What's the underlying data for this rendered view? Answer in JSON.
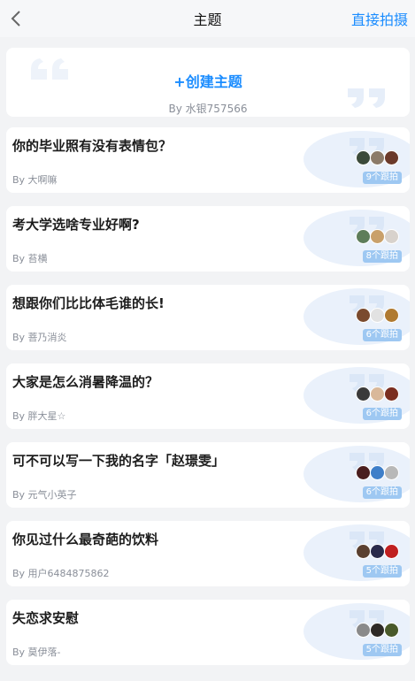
{
  "nav": {
    "title": "主题",
    "action_label": "直接拍摄"
  },
  "create": {
    "label": "+创建主题",
    "byline": "By 水银757566"
  },
  "topics": [
    {
      "title": "你的毕业照有没有表情包？",
      "author": "By 大啊嘛",
      "count": "9个跟拍",
      "avatar_colors": [
        "#3b4a3a",
        "#8b7a68",
        "#6b3a2a"
      ]
    },
    {
      "title": "考大学选啥专业好啊?",
      "author": "By 苔横",
      "count": "8个跟拍",
      "avatar_colors": [
        "#5e7d5a",
        "#c9a06a",
        "#d8d2cc"
      ]
    },
    {
      "title": "想跟你们比比体毛谁的长!",
      "author": "By 菩乃消炎",
      "count": "6个跟拍",
      "avatar_colors": [
        "#7a4a2e",
        "#e2e2e2",
        "#b07a30"
      ]
    },
    {
      "title": "大家是怎么消暑降温的？",
      "author": "By 胖大星☆",
      "count": "6个跟拍",
      "avatar_colors": [
        "#3a3a3a",
        "#d9b89a",
        "#7a2e20"
      ]
    },
    {
      "title": "可不可以写一下我的名字「赵璟雯」",
      "author": "By 元气小英子",
      "count": "6个跟拍",
      "avatar_colors": [
        "#4a1e1e",
        "#3f7fc9",
        "#b8b8b8"
      ]
    },
    {
      "title": "你见过什么最奇葩的饮料",
      "author": "By 用户6484875862",
      "count": "5个跟拍",
      "avatar_colors": [
        "#5a4030",
        "#2a2a4a",
        "#c02020"
      ]
    },
    {
      "title": "失恋求安慰",
      "author": "By 莫伊落-",
      "count": "5个跟拍",
      "avatar_colors": [
        "#8a8a8a",
        "#2e2a26",
        "#4a5a2a"
      ]
    }
  ]
}
